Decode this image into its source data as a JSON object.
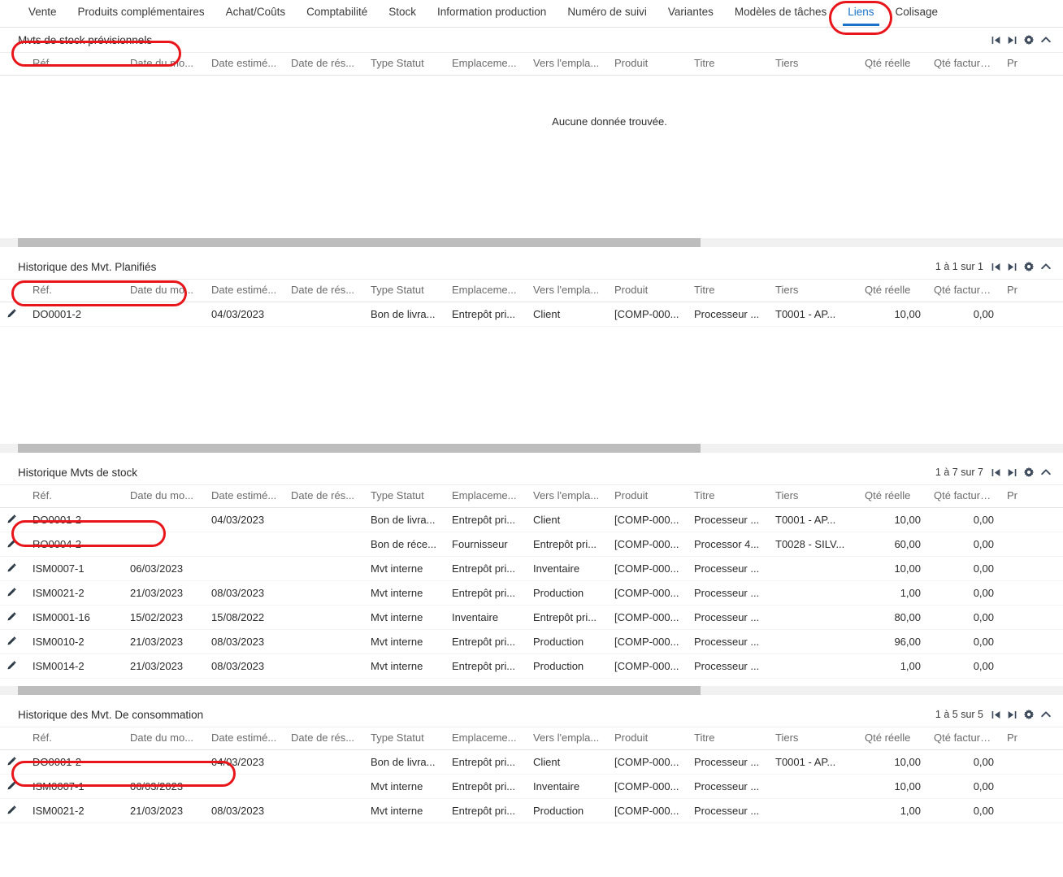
{
  "tabs": [
    {
      "label": "Vente",
      "active": false
    },
    {
      "label": "Produits complémentaires",
      "active": false
    },
    {
      "label": "Achat/Coûts",
      "active": false
    },
    {
      "label": "Comptabilité",
      "active": false
    },
    {
      "label": "Stock",
      "active": false
    },
    {
      "label": "Information production",
      "active": false
    },
    {
      "label": "Numéro de suivi",
      "active": false
    },
    {
      "label": "Variantes",
      "active": false
    },
    {
      "label": "Modèles de tâches",
      "active": false
    },
    {
      "label": "Liens",
      "active": true
    },
    {
      "label": "Colisage",
      "active": false
    }
  ],
  "columns": [
    "Réf.",
    "Date du mo...",
    "Date estimé...",
    "Date de rés...",
    "Type Statut",
    "Emplaceme...",
    "Vers l'empla...",
    "Produit",
    "Titre",
    "Tiers",
    "Qté réelle",
    "Qté facturé...",
    "Pr"
  ],
  "icons": {
    "first_page": "first-page-icon",
    "last_page": "last-page-icon",
    "settings": "gear-icon",
    "collapse": "chevron-up-icon",
    "edit": "pencil-icon"
  },
  "empty_message": "Aucune donnée trouvée.",
  "sections": [
    {
      "title": "Mvts de stock prévisionnels",
      "count": "",
      "empty": true,
      "rows": []
    },
    {
      "title": "Historique des Mvt. Planifiés",
      "count": "1 à 1 sur 1",
      "empty": false,
      "rows": [
        {
          "ref": "DO0001-2",
          "date_mo": "",
          "date_est": "04/03/2023",
          "date_res": "",
          "type": "Bon de livra...",
          "empl": "Entrepôt pri...",
          "vers": "Client",
          "produit": "[COMP-000...",
          "titre": "Processeur ...",
          "tiers": "T0001 - AP...",
          "qte_reelle": "10,00",
          "qte_facture": "0,00"
        }
      ]
    },
    {
      "title": "Historique Mvts de stock",
      "count": "1 à 7 sur 7",
      "empty": false,
      "rows": [
        {
          "ref": "DO0001-2",
          "date_mo": "",
          "date_est": "04/03/2023",
          "date_res": "",
          "type": "Bon de livra...",
          "empl": "Entrepôt pri...",
          "vers": "Client",
          "produit": "[COMP-000...",
          "titre": "Processeur ...",
          "tiers": "T0001 - AP...",
          "qte_reelle": "10,00",
          "qte_facture": "0,00"
        },
        {
          "ref": "RO0004-2",
          "date_mo": "",
          "date_est": "",
          "date_res": "",
          "type": "Bon de réce...",
          "empl": "Fournisseur",
          "vers": "Entrepôt pri...",
          "produit": "[COMP-000...",
          "titre": "Processor 4...",
          "tiers": "T0028 - SILV...",
          "qte_reelle": "60,00",
          "qte_facture": "0,00"
        },
        {
          "ref": "ISM0007-1",
          "date_mo": "06/03/2023",
          "date_est": "",
          "date_res": "",
          "type": "Mvt interne",
          "empl": "Entrepôt pri...",
          "vers": "Inventaire",
          "produit": "[COMP-000...",
          "titre": "Processeur ...",
          "tiers": "",
          "qte_reelle": "10,00",
          "qte_facture": "0,00"
        },
        {
          "ref": "ISM0021-2",
          "date_mo": "21/03/2023",
          "date_est": "08/03/2023",
          "date_res": "",
          "type": "Mvt interne",
          "empl": "Entrepôt pri...",
          "vers": "Production",
          "produit": "[COMP-000...",
          "titre": "Processeur ...",
          "tiers": "",
          "qte_reelle": "1,00",
          "qte_facture": "0,00"
        },
        {
          "ref": "ISM0001-16",
          "date_mo": "15/02/2023",
          "date_est": "15/08/2022",
          "date_res": "",
          "type": "Mvt interne",
          "empl": "Inventaire",
          "vers": "Entrepôt pri...",
          "produit": "[COMP-000...",
          "titre": "Processeur ...",
          "tiers": "",
          "qte_reelle": "80,00",
          "qte_facture": "0,00"
        },
        {
          "ref": "ISM0010-2",
          "date_mo": "21/03/2023",
          "date_est": "08/03/2023",
          "date_res": "",
          "type": "Mvt interne",
          "empl": "Entrepôt pri...",
          "vers": "Production",
          "produit": "[COMP-000...",
          "titre": "Processeur ...",
          "tiers": "",
          "qte_reelle": "96,00",
          "qte_facture": "0,00"
        },
        {
          "ref": "ISM0014-2",
          "date_mo": "21/03/2023",
          "date_est": "08/03/2023",
          "date_res": "",
          "type": "Mvt interne",
          "empl": "Entrepôt pri...",
          "vers": "Production",
          "produit": "[COMP-000...",
          "titre": "Processeur ...",
          "tiers": "",
          "qte_reelle": "1,00",
          "qte_facture": "0,00"
        }
      ]
    },
    {
      "title": "Historique des Mvt. De consommation",
      "count": "1 à 5 sur 5",
      "empty": false,
      "rows": [
        {
          "ref": "DO0001-2",
          "date_mo": "",
          "date_est": "04/03/2023",
          "date_res": "",
          "type": "Bon de livra...",
          "empl": "Entrepôt pri...",
          "vers": "Client",
          "produit": "[COMP-000...",
          "titre": "Processeur ...",
          "tiers": "T0001 - AP...",
          "qte_reelle": "10,00",
          "qte_facture": "0,00"
        },
        {
          "ref": "ISM0007-1",
          "date_mo": "06/03/2023",
          "date_est": "",
          "date_res": "",
          "type": "Mvt interne",
          "empl": "Entrepôt pri...",
          "vers": "Inventaire",
          "produit": "[COMP-000...",
          "titre": "Processeur ...",
          "tiers": "",
          "qte_reelle": "10,00",
          "qte_facture": "0,00"
        },
        {
          "ref": "ISM0021-2",
          "date_mo": "21/03/2023",
          "date_est": "08/03/2023",
          "date_res": "",
          "type": "Mvt interne",
          "empl": "Entrepôt pri...",
          "vers": "Production",
          "produit": "[COMP-000...",
          "titre": "Processeur ...",
          "tiers": "",
          "qte_reelle": "1,00",
          "qte_facture": "0,00"
        }
      ]
    }
  ],
  "colors": {
    "accent": "#1a73c8",
    "annotation": "#e8161a",
    "text": "#2b2b2b",
    "header_text": "#6b6b6b"
  }
}
